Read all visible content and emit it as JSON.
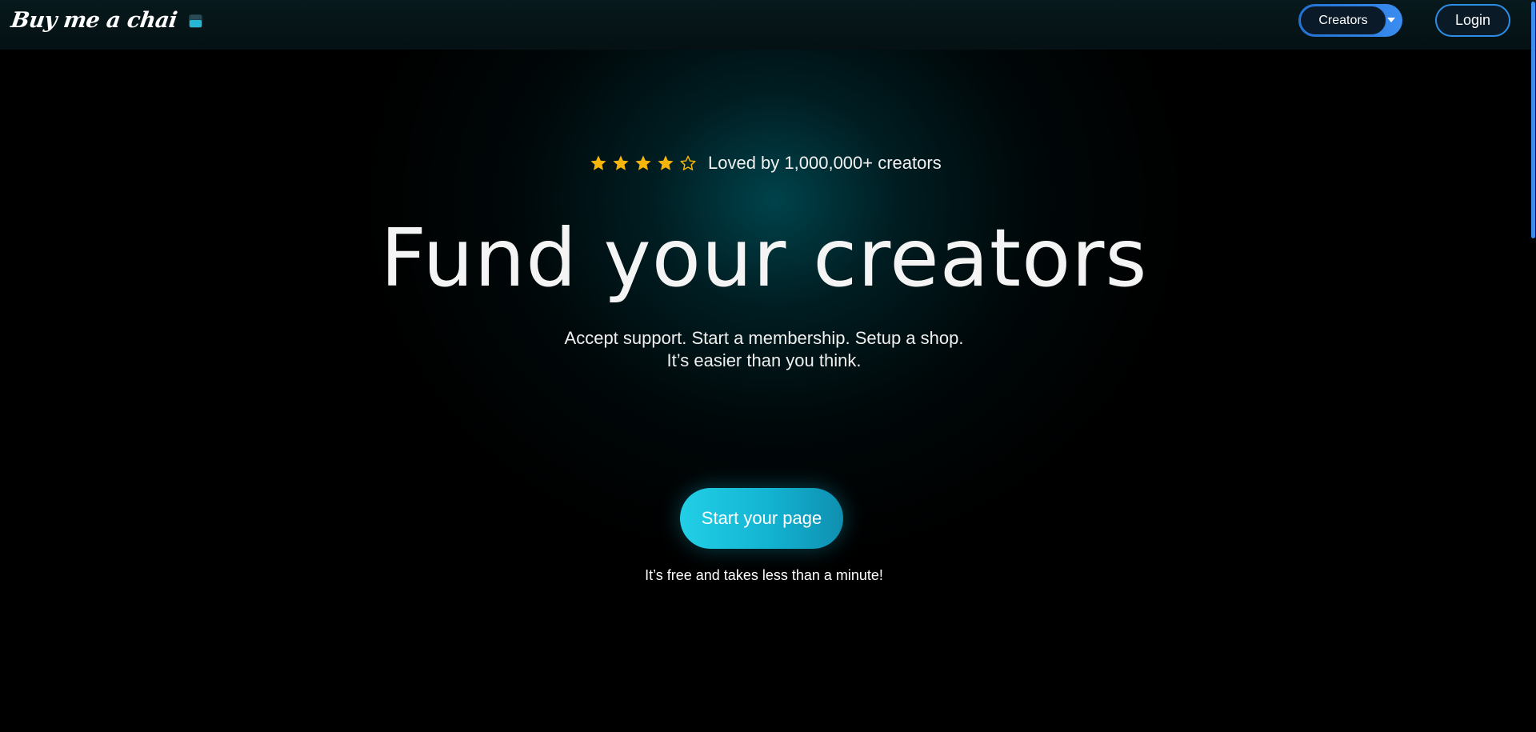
{
  "header": {
    "logo_text": "Buy me a chai",
    "logo_icon": "chai-cup-icon",
    "creators_label": "Creators",
    "login_label": "Login"
  },
  "hero": {
    "rating": {
      "filled_stars": 4,
      "total_stars": 5,
      "text": "Loved by 1,000,000+ creators"
    },
    "title": "Fund your creators",
    "subtitle_line1": "Accept support. Start a membership. Setup a shop.",
    "subtitle_line2": "It’s easier than you think.",
    "cta_label": "Start your page",
    "cta_note": "It’s free and takes less than a minute!"
  },
  "colors": {
    "background": "#000000",
    "accent_cyan": "#1cc4e0",
    "accent_blue": "#2d8ee8",
    "star_gold": "#f5b50a"
  }
}
